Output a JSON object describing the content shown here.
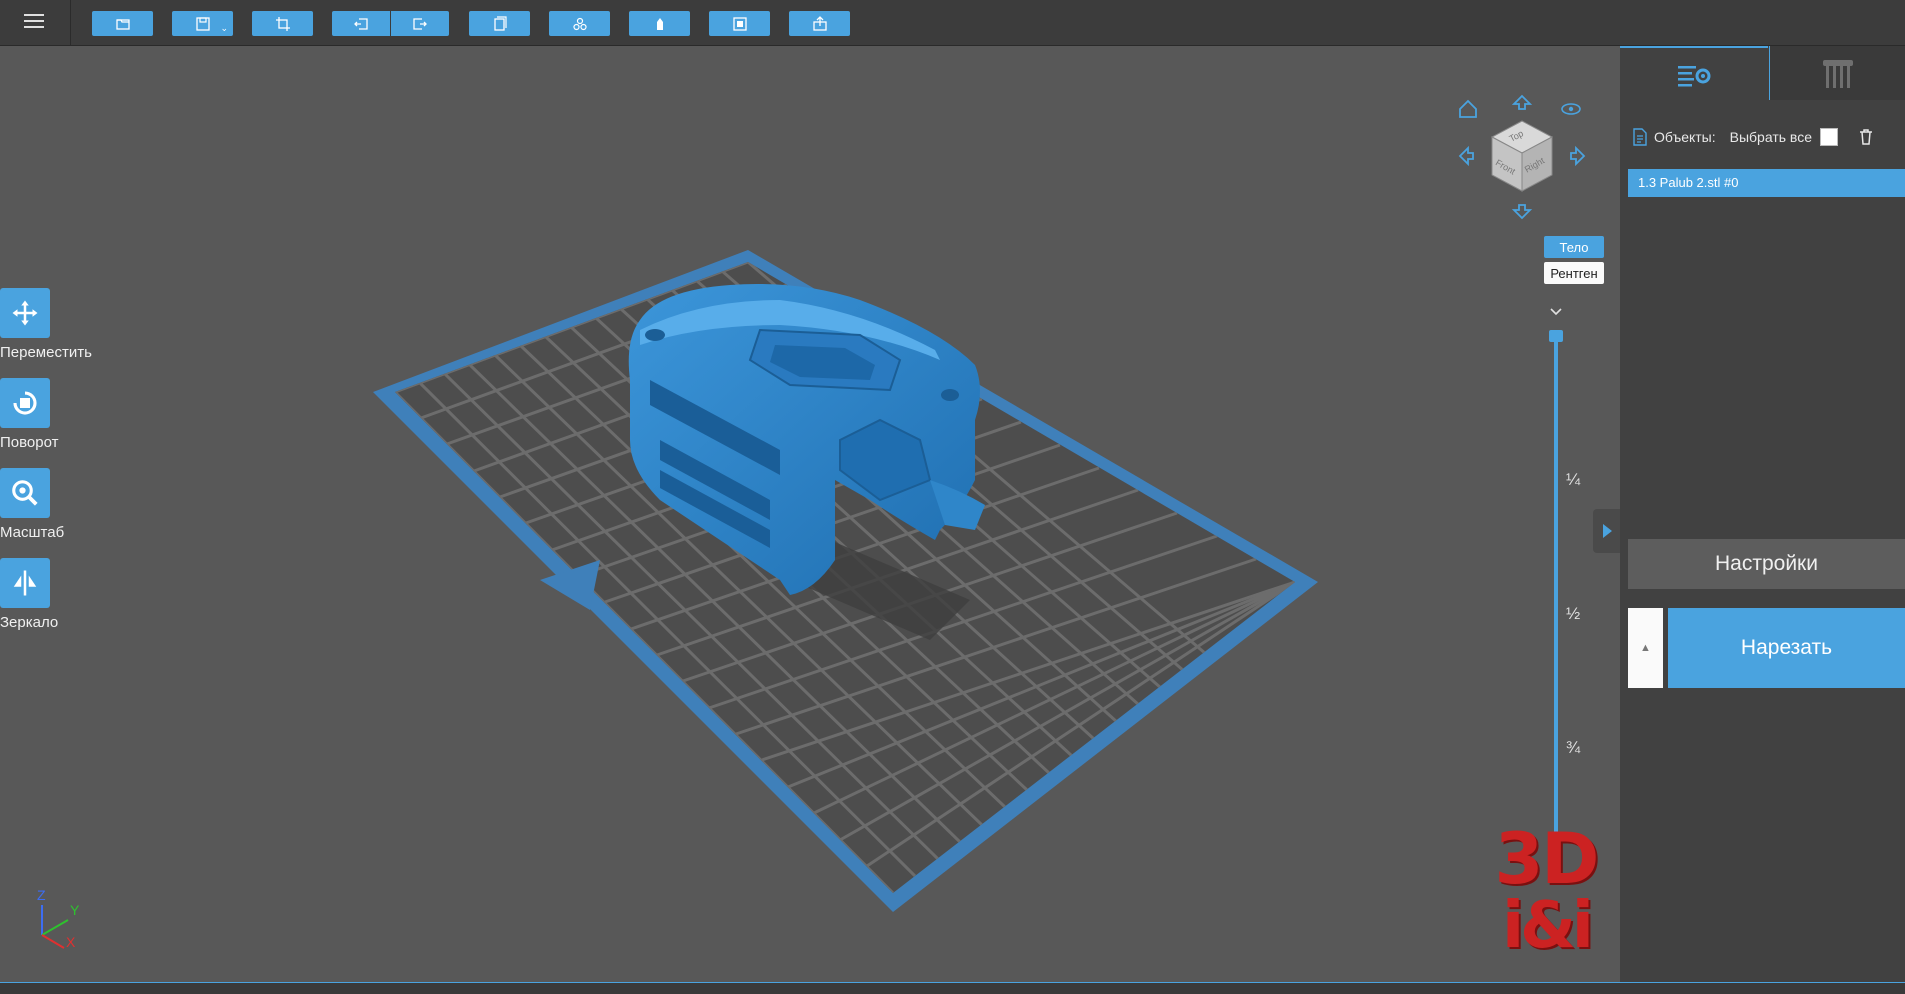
{
  "toolbar": {
    "menu_icon": "hamburger-menu-icon",
    "buttons": [
      "open-file-icon",
      "save-icon",
      "crop-icon",
      "undo-icon",
      "redo-icon",
      "copy-icon",
      "arrange-icon",
      "support-icon",
      "view-icon",
      "export-icon"
    ]
  },
  "tools": [
    {
      "label": "Переместить",
      "icon": "move-icon"
    },
    {
      "label": "Поворот",
      "icon": "rotate-icon"
    },
    {
      "label": "Масштаб",
      "icon": "scale-icon"
    },
    {
      "label": "Зеркало",
      "icon": "mirror-icon"
    }
  ],
  "view_cube": {
    "top": "Top",
    "front": "Front",
    "right": "Right"
  },
  "render_modes": {
    "body": "Тело",
    "xray": "Рентген",
    "active": "body"
  },
  "layer_slider": {
    "labels": [
      "¼",
      "½",
      "¾"
    ],
    "value": 0
  },
  "logo": {
    "line1": "3D",
    "line2": "i&i"
  },
  "axes": {
    "x": "X",
    "y": "Y",
    "z": "Z"
  },
  "panel": {
    "objects_label": "Объекты:",
    "select_all_label": "Выбрать все",
    "selected_object": "1.3 Palub 2.stl #0",
    "settings_label": "Настройки",
    "slice_label": "Нарезать",
    "expand_glyph": "▲"
  },
  "colors": {
    "accent": "#4aa3df",
    "viewport": "#585858",
    "panel": "#414141",
    "model": "#2f86c9",
    "logo": "#cc2222"
  }
}
